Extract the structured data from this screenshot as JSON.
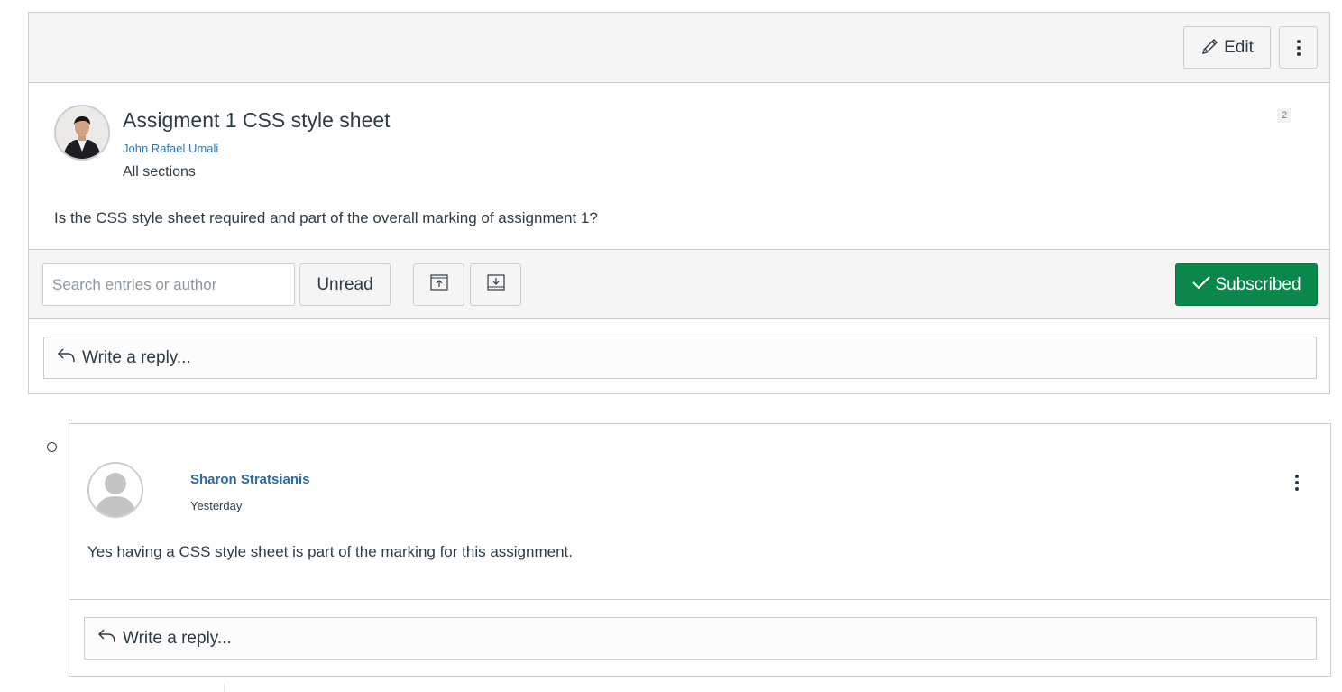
{
  "topic": {
    "edit_label": "Edit",
    "title": "Assigment 1 CSS style sheet",
    "author": "John Rafael Umali",
    "sections": "All sections",
    "reply_count": "2",
    "message": "Is the CSS style sheet required and part of the overall marking of assignment 1?"
  },
  "toolbar": {
    "search_placeholder": "Search entries or author",
    "unread_label": "Unread",
    "subscribed_label": "Subscribed",
    "subscribed_color": "#0b874b"
  },
  "reply_label": "Write a reply...",
  "entry": {
    "author": "Sharon Stratsianis",
    "time": "Yesterday",
    "message": "Yes having a CSS style sheet is part of the marking for this assignment."
  },
  "icons": [
    "pencil-icon",
    "kebab-menu-icon",
    "expand-up-icon",
    "collapse-down-icon",
    "checkmark-icon",
    "reply-arrow-icon",
    "unread-indicator-icon"
  ]
}
